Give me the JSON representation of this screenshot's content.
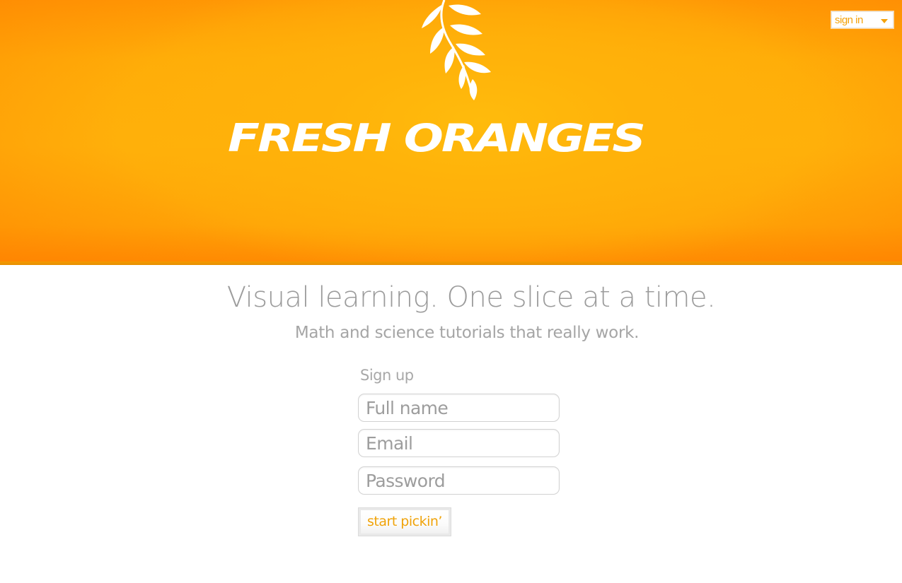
{
  "header": {
    "brand": "FRESH ORANGES",
    "logo_icon": "leaf-branch-icon",
    "signin_label": "sign in",
    "signin_caret_icon": "caret-down-icon"
  },
  "hero": {
    "tagline": "Visual learning. One slice at a time.",
    "subtagline": "Math and science tutorials that really work."
  },
  "signup": {
    "title": "Sign up",
    "fields": {
      "full_name_placeholder": "Full name",
      "email_placeholder": "Email",
      "password_placeholder": "Password"
    },
    "submit_label": "start pickin’"
  },
  "colors": {
    "brand_orange": "#ffb00a",
    "accent_text": "#f0a30a",
    "muted_text": "#9c9c9c"
  }
}
